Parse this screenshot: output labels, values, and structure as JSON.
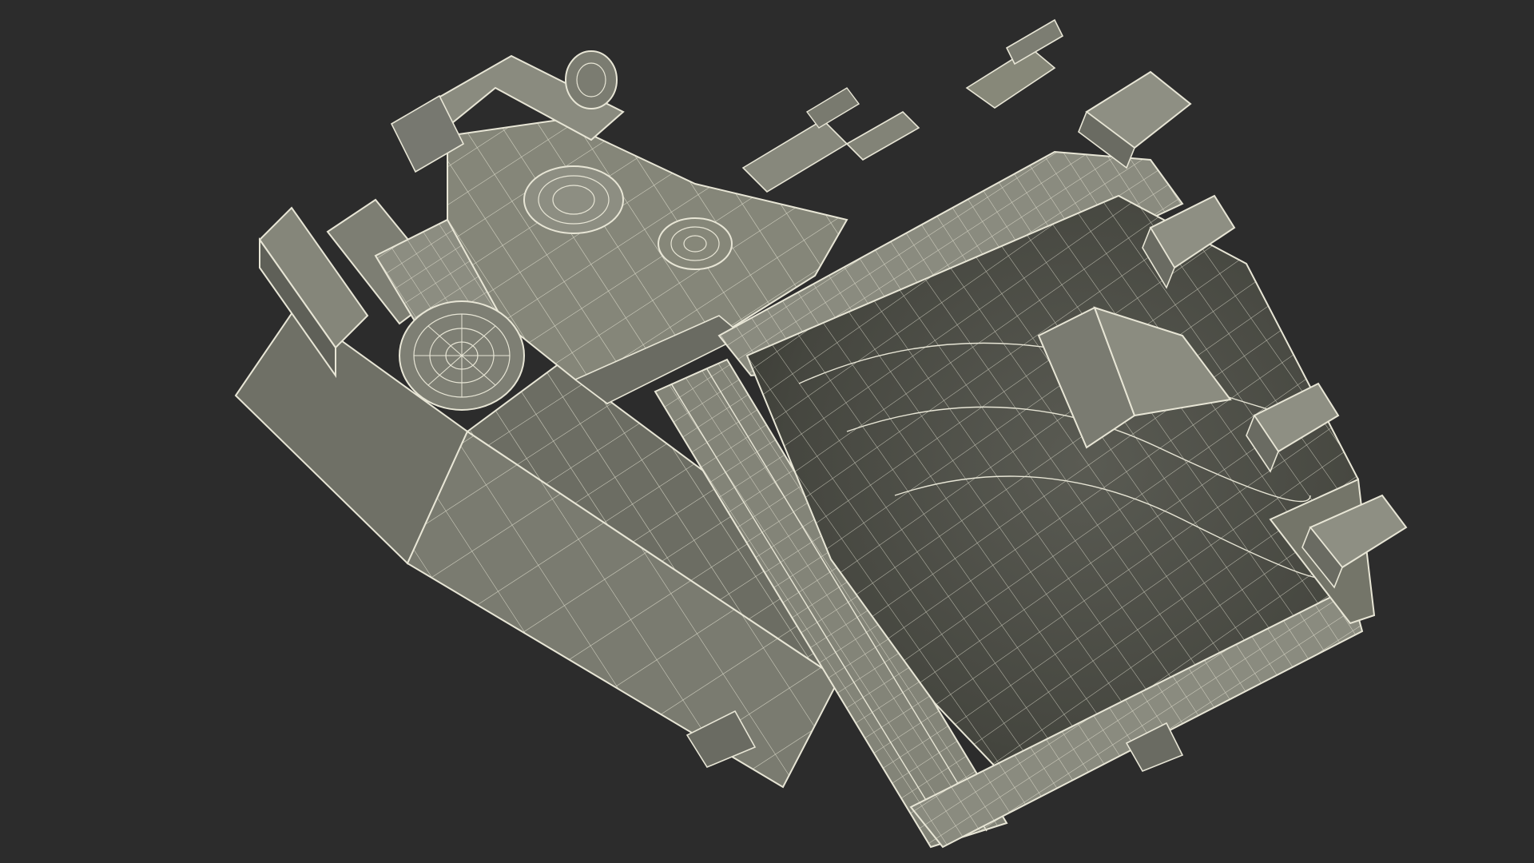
{
  "scene": {
    "subject": "wireframe-render",
    "background_color": "#2c2c2c",
    "surface_color": "#7a7b70",
    "surface_light_color": "#8c8d81",
    "surface_dark_color": "#55574e",
    "cavity_color": "#4a4b44",
    "wire_color": "#e8e6d6"
  }
}
